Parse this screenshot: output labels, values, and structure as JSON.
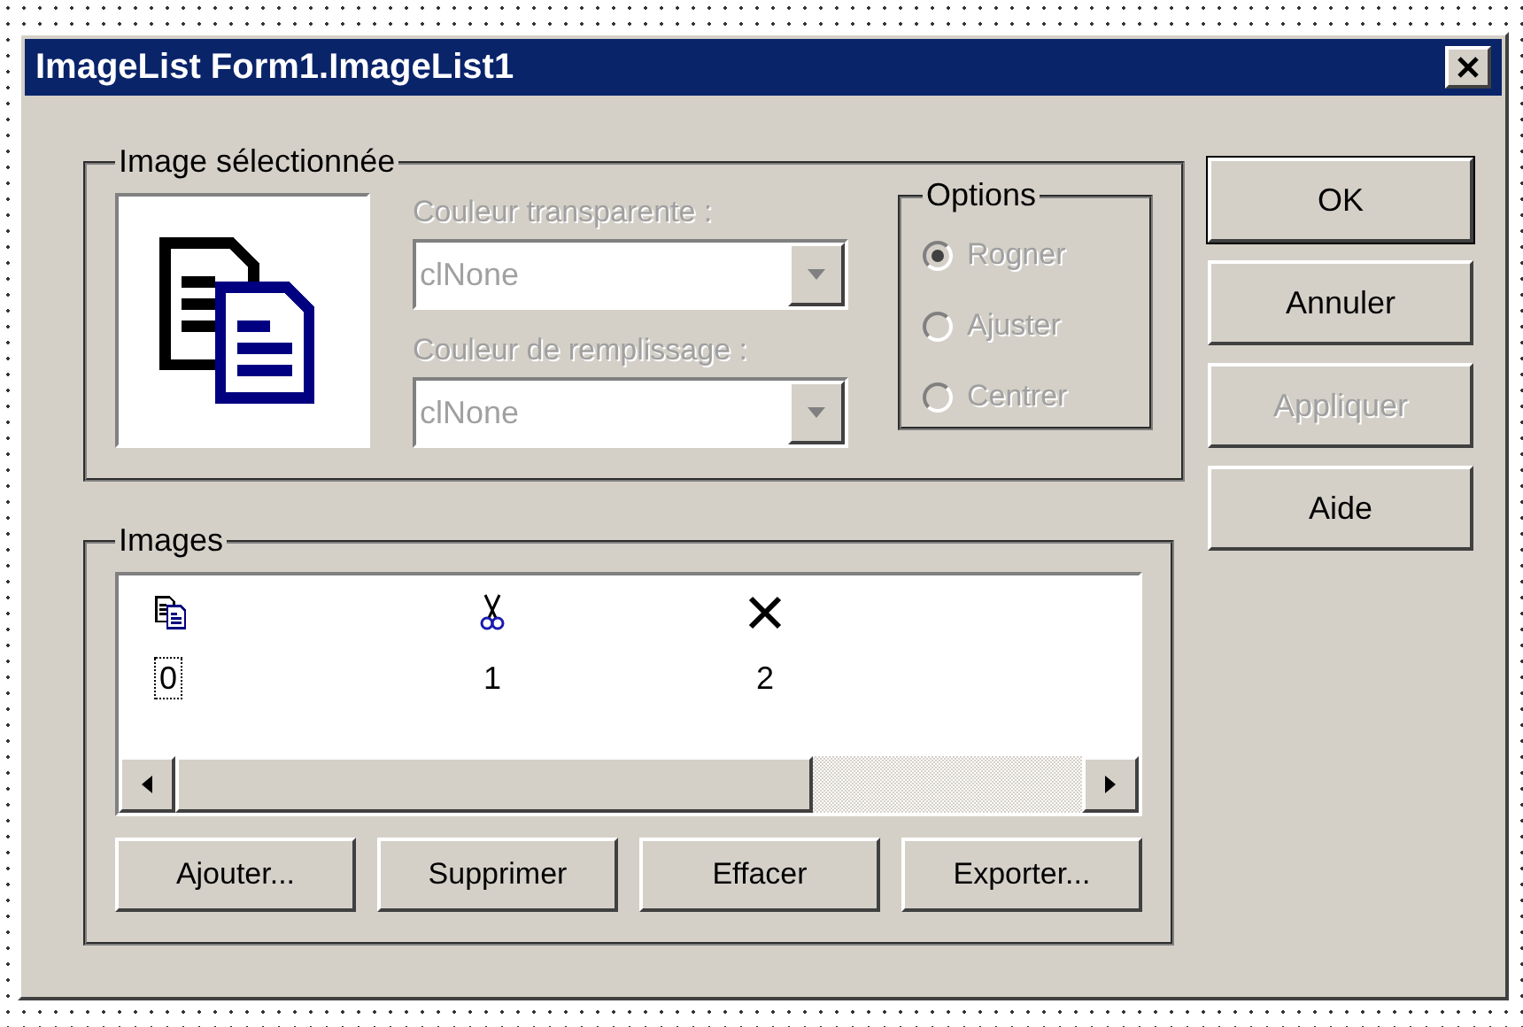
{
  "window": {
    "title": "ImageList Form1.ImageList1"
  },
  "selected_image": {
    "label": "Image sélectionnée",
    "fields": [
      {
        "label": "Couleur transparente :",
        "value": "clNone",
        "disabled": true
      },
      {
        "label": "Couleur de remplissage :",
        "value": "clNone",
        "disabled": true
      }
    ],
    "options": {
      "label": "Options",
      "radios": [
        {
          "label": "Rogner",
          "selected": true,
          "disabled": true
        },
        {
          "label": "Ajuster",
          "selected": false,
          "disabled": true
        },
        {
          "label": "Centrer",
          "selected": false,
          "disabled": true
        }
      ]
    }
  },
  "buttons": [
    {
      "label": "OK",
      "default": true,
      "disabled": false
    },
    {
      "label": "Annuler",
      "default": false,
      "disabled": false
    },
    {
      "label": "Appliquer",
      "default": false,
      "disabled": true
    },
    {
      "label": "Aide",
      "default": false,
      "disabled": false
    }
  ],
  "images": {
    "label": "Images",
    "items": [
      {
        "kind": "copy",
        "caption": "0",
        "selected": true
      },
      {
        "kind": "cut",
        "caption": "1",
        "selected": false
      },
      {
        "kind": "delete",
        "caption": "2",
        "selected": false
      }
    ],
    "buttons": [
      "Ajouter...",
      "Supprimer",
      "Effacer",
      "Exporter..."
    ]
  }
}
